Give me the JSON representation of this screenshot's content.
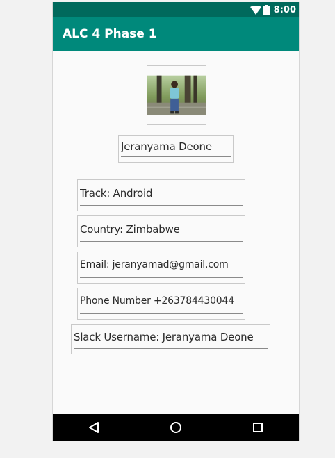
{
  "status_bar": {
    "time": "8:00",
    "icons": [
      "wifi-icon",
      "battery-icon"
    ]
  },
  "app_bar": {
    "title": "ALC 4 Phase 1"
  },
  "profile": {
    "photo": "profile-photo",
    "name": "Jeranyama Deone"
  },
  "fields": {
    "track": "Track: Android",
    "country": "Country: Zimbabwe",
    "email": "Email: jeranyamad@gmail.com",
    "phone": "Phone Number +263784430044",
    "slack": "Slack Username: Jeranyama Deone"
  },
  "nav_bar": {
    "buttons": [
      "back-icon",
      "home-icon",
      "recents-icon"
    ]
  },
  "colors": {
    "status_bar": "#00695c",
    "app_bar": "#00897b",
    "background": "#fafafa",
    "nav_bar": "#000000"
  }
}
